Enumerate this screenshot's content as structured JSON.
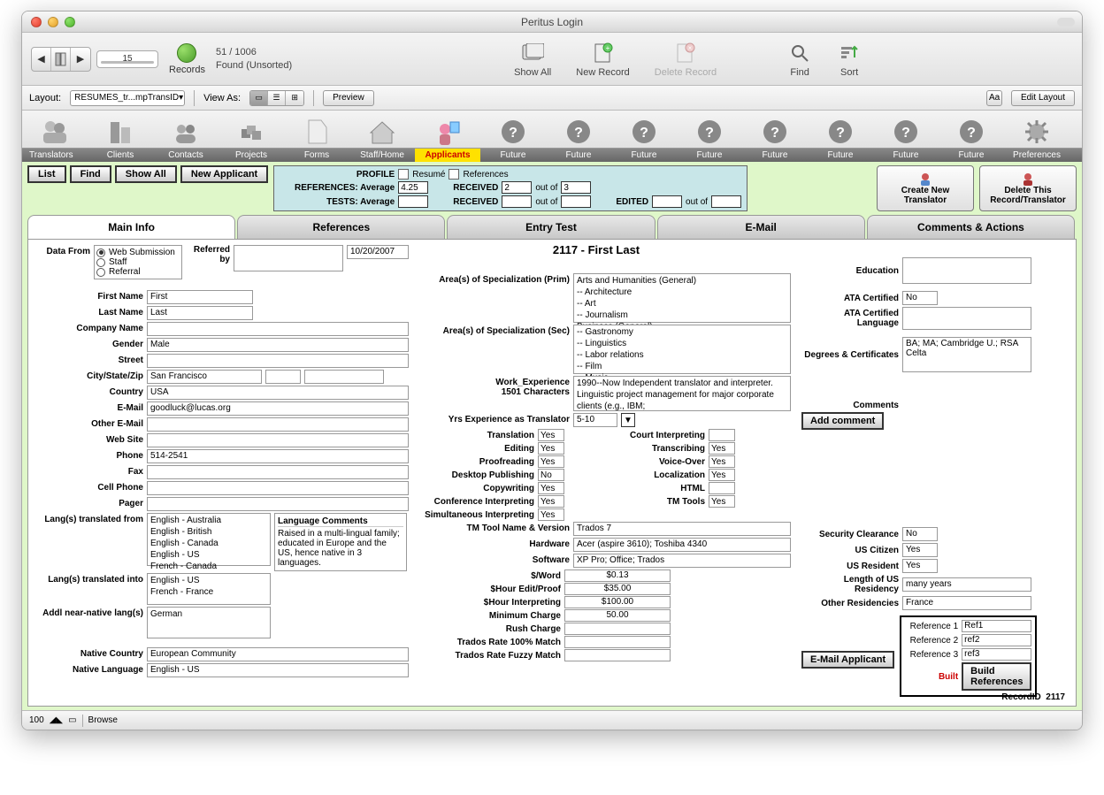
{
  "window": {
    "title": "Peritus Login"
  },
  "toolbar1": {
    "slider_value": "15",
    "found": "51 / 1006",
    "found_sub": "Found (Unsorted)",
    "records": "Records",
    "show_all": "Show All",
    "new_record": "New Record",
    "delete_record": "Delete Record",
    "find": "Find",
    "sort": "Sort"
  },
  "toolbar2": {
    "layout_label": "Layout:",
    "layout_value": "RESUMES_tr...mpTransID",
    "view_as": "View As:",
    "preview": "Preview",
    "edit_layout": "Edit Layout"
  },
  "iconrow": {
    "labels": [
      "Translators",
      "Clients",
      "Contacts",
      "Projects",
      "Forms",
      "Staff/Home",
      "Applicants",
      "Future",
      "Future",
      "Future",
      "Future",
      "Future",
      "Future",
      "Future",
      "Future",
      "Preferences"
    ],
    "active_index": 6
  },
  "midbar": {
    "list": "List",
    "find": "Find",
    "show_all": "Show All",
    "new_applicant": "New Applicant",
    "profile": "PROFILE",
    "resume": "Resumé",
    "references": "References",
    "refs_avg_label": "REFERENCES: Average",
    "refs_avg_value": "4.25",
    "received1_label": "RECEIVED",
    "received1_value": "2",
    "outof": "out of",
    "received1_total": "3",
    "tests_avg_label": "TESTS: Average",
    "tests_avg_value": "",
    "received2_label": "RECEIVED",
    "received2_value": "",
    "received2_total": "",
    "edited_label": "EDITED",
    "edited_value": "",
    "edited_total": "",
    "create_new": "Create New",
    "translator": "Translator",
    "delete_this": "Delete This",
    "record_translator": "Record/Translator"
  },
  "tabs": [
    "Main Info",
    "References",
    "Entry Test",
    "E-Mail",
    "Comments & Actions"
  ],
  "record_title": "2117 - First Last",
  "c1": {
    "data_from": "Data From",
    "radios": [
      "Web Submission",
      "Staff",
      "Referral"
    ],
    "referred_by": "Referred by",
    "referred_by_val": "",
    "referred_date": "10/20/2007",
    "first_name": "First Name",
    "first_name_val": "First",
    "last_name": "Last Name",
    "last_name_val": "Last",
    "company": "Company Name",
    "company_val": "",
    "gender": "Gender",
    "gender_val": "Male",
    "street": "Street",
    "street_val": "",
    "csz": "City/State/Zip",
    "city_val": "San Francisco",
    "state_val": "",
    "zip_val": "",
    "country": "Country",
    "country_val": "USA",
    "email": "E-Mail",
    "email_val": "goodluck@lucas.org",
    "other_email": "Other E-Mail",
    "other_email_val": "",
    "website": "Web Site",
    "website_val": "",
    "phone": "Phone",
    "phone_val": "514-2541",
    "fax": "Fax",
    "fax_val": "",
    "cell": "Cell Phone",
    "cell_val": "",
    "pager": "Pager",
    "pager_val": "",
    "lang_from": "Lang(s) translated from",
    "lang_from_val": "English - Australia\nEnglish - British\nEnglish - Canada\nEnglish - US\nFrench - Canada",
    "lang_to": "Lang(s) translated into",
    "lang_to_val": "English - US\nFrench - France",
    "addl_lang": "Addl near-native lang(s)",
    "addl_lang_val": "German",
    "lang_comments_title": "Language Comments",
    "lang_comments_val": "Raised in a multi-lingual family; educated in Europe and the US, hence native in 3 languages.",
    "native_country": "Native Country",
    "native_country_val": "European Community",
    "native_language": "Native Language",
    "native_language_val": "English - US"
  },
  "c2": {
    "spec_prim": "Area(s) of Specialization (Prim)",
    "spec_prim_val": "Arts and Humanities (General)\n-- Architecture\n-- Art\n-- Journalism\nBusiness (General)",
    "spec_sec": "Area(s) of Specialization (Sec)",
    "spec_sec_val": "-- Gastronomy\n-- Linguistics\n-- Labor relations\n-- Film\n-- Music",
    "work_exp": "Work_Experience",
    "work_exp_chars": "1501 Characters",
    "work_exp_val": "1990--Now   Independent translator and interpreter. Linguistic project management for major corporate clients (e.g., IBM;",
    "yrs_exp": "Yrs Experience as Translator",
    "yrs_exp_val": "5-10",
    "skills_left": [
      {
        "label": "Translation",
        "val": "Yes"
      },
      {
        "label": "Editing",
        "val": "Yes"
      },
      {
        "label": "Proofreading",
        "val": "Yes"
      },
      {
        "label": "Desktop Publishing",
        "val": "No"
      },
      {
        "label": "Copywriting",
        "val": "Yes"
      },
      {
        "label": "Conference Interpreting",
        "val": "Yes"
      },
      {
        "label": "Simultaneous Interpreting",
        "val": "Yes"
      }
    ],
    "skills_right": [
      {
        "label": "Court Interpreting",
        "val": ""
      },
      {
        "label": "Transcribing",
        "val": "Yes"
      },
      {
        "label": "Voice-Over",
        "val": "Yes"
      },
      {
        "label": "Localization",
        "val": "Yes"
      },
      {
        "label": "HTML",
        "val": ""
      },
      {
        "label": "TM Tools",
        "val": "Yes"
      }
    ],
    "tm_tool": "TM Tool Name & Version",
    "tm_tool_val": "Trados 7",
    "hardware": "Hardware",
    "hardware_val": "Acer (aspire 3610); Toshiba 4340",
    "software": "Software",
    "software_val": "XP Pro; Office; Trados",
    "rates": [
      {
        "label": "$/Word",
        "val": "$0.13"
      },
      {
        "label": "$Hour Edit/Proof",
        "val": "$35.00"
      },
      {
        "label": "$Hour Interpreting",
        "val": "$100.00"
      },
      {
        "label": "Minimum Charge",
        "val": "50.00"
      },
      {
        "label": "Rush Charge",
        "val": ""
      },
      {
        "label": "Trados Rate 100% Match",
        "val": ""
      },
      {
        "label": "Trados Rate Fuzzy Match",
        "val": ""
      }
    ]
  },
  "c3": {
    "education": "Education",
    "education_val": "",
    "ata_cert": "ATA Certified",
    "ata_cert_val": "No",
    "ata_lang": "ATA Certified Language",
    "ata_lang_val": "",
    "degrees": "Degrees & Certificates",
    "degrees_val": "BA; MA; Cambridge U.; RSA Celta",
    "comments": "Comments",
    "add_comment": "Add comment",
    "sec_clear": "Security Clearance",
    "sec_clear_val": "No",
    "us_cit": "US Citizen",
    "us_cit_val": "Yes",
    "us_res": "US Resident",
    "us_res_val": "Yes",
    "len_res": "Length of US Residency",
    "len_res_val": "many years",
    "other_res": "Other Residencies",
    "other_res_val": "France",
    "email_applicant": "E-Mail Applicant",
    "ref1": "Reference 1",
    "ref1_val": "Ref1",
    "ref2": "Reference 2",
    "ref2_val": "ref2",
    "ref3": "Reference 3",
    "ref3_val": "ref3",
    "built": "Built",
    "build_refs": "Build References"
  },
  "footer": {
    "recordid_label": "RecordID",
    "recordid_val": "2117"
  },
  "status": {
    "zoom": "100",
    "mode": "Browse"
  }
}
